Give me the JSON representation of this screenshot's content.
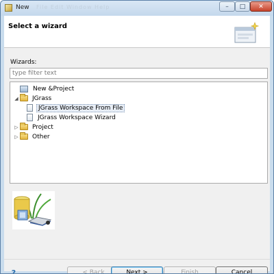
{
  "window": {
    "title": "New",
    "menu_ghost": "File   Edit   Window   Help",
    "controls": {
      "minimize": "–",
      "maximize": "□",
      "close": "✕"
    }
  },
  "banner": {
    "title": "Select a wizard",
    "icon": "new-wizard-icon"
  },
  "wizards_label": "Wizards:",
  "filter": {
    "placeholder": "type filter text",
    "value": ""
  },
  "tree": {
    "items": [
      {
        "label": "New &Project",
        "icon": "new-project-icon",
        "toggle": ""
      },
      {
        "label": "JGrass",
        "icon": "folder-icon",
        "toggle": "◢"
      },
      {
        "label": "JGrass Workspace From File",
        "icon": "document-icon",
        "toggle": "",
        "selected": true
      },
      {
        "label": "JGrass Workspace Wizard",
        "icon": "document-icon",
        "toggle": ""
      },
      {
        "label": "Project",
        "icon": "folder-icon",
        "toggle": "▷"
      },
      {
        "label": "Other",
        "icon": "folder-icon",
        "toggle": "▷"
      }
    ]
  },
  "buttons": {
    "help": "?",
    "back": "< Back",
    "next": "Next >",
    "finish": "Finish",
    "cancel": "Cancel"
  },
  "colors": {
    "accent": "#3c7fb1",
    "selection": "#e8eef6",
    "titlebar": "#c9dced"
  }
}
